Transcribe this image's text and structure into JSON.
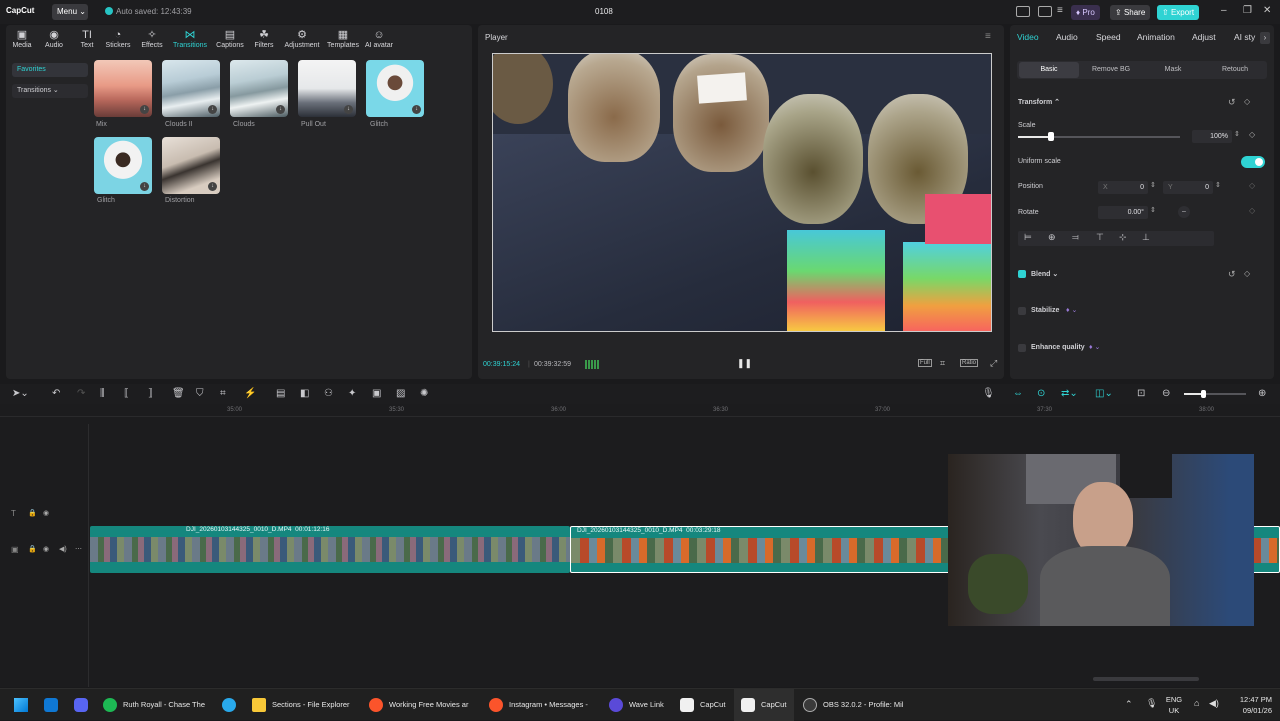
{
  "titlebar": {
    "logo": "CapCut",
    "menu": "Menu ⌄",
    "autosave": "Auto saved: 12:43:39",
    "project": "0108",
    "pro": "Pro",
    "share": "Share",
    "export": "Export"
  },
  "toptabs": [
    {
      "label": "Media",
      "icon": "media-icon"
    },
    {
      "label": "Audio",
      "icon": "audio-icon"
    },
    {
      "label": "Text",
      "icon": "text-icon"
    },
    {
      "label": "Stickers",
      "icon": "stickers-icon"
    },
    {
      "label": "Effects",
      "icon": "effects-icon"
    },
    {
      "label": "Transitions",
      "icon": "transitions-icon",
      "active": true
    },
    {
      "label": "Captions",
      "icon": "captions-icon"
    },
    {
      "label": "Filters",
      "icon": "filters-icon"
    },
    {
      "label": "Adjustment",
      "icon": "adjustment-icon"
    },
    {
      "label": "Templates",
      "icon": "templates-icon"
    },
    {
      "label": "AI avatar",
      "icon": "ai-avatar-icon"
    }
  ],
  "sidebar": {
    "favorites": "Favorites",
    "transitions": "Transitions ⌄"
  },
  "thumbs": [
    {
      "label": "Mix"
    },
    {
      "label": "Clouds II"
    },
    {
      "label": "Clouds"
    },
    {
      "label": "Pull Out"
    },
    {
      "label": "Glitch"
    },
    {
      "label": "Glitch"
    },
    {
      "label": "Distortion"
    }
  ],
  "player": {
    "title": "Player",
    "current": "00:39:15:24",
    "total": "00:39:32:59",
    "full": "Full",
    "ratio": "Ratio"
  },
  "props": {
    "tabs": [
      "Video",
      "Audio",
      "Speed",
      "Animation",
      "Adjust",
      "AI sty"
    ],
    "subtabs": [
      "Basic",
      "Remove BG",
      "Mask",
      "Retouch"
    ],
    "transform": "Transform ⌃",
    "scale": "Scale",
    "scale_val": "100%",
    "uniform": "Uniform scale",
    "position": "Position",
    "pos_x_label": "X",
    "pos_x": "0",
    "pos_y_label": "Y",
    "pos_y": "0",
    "rotate": "Rotate",
    "rotate_val": "0.00°",
    "blend": "Blend ⌄",
    "stabilize": "Stabilize",
    "enhance": "Enhance quality"
  },
  "ruler": [
    "35:00",
    "35:30",
    "36:00",
    "36:30",
    "37:00",
    "37:30",
    "38:00"
  ],
  "clips": [
    {
      "name": "DJI_20260103144325_0010_D.MP4",
      "duration": "00:01:12:16"
    },
    {
      "name": "DJI_20260103144325_0010_D.MP4",
      "duration": "00:03:29:18"
    }
  ],
  "taskbar": {
    "apps": [
      "Ruth Royall - Chase The",
      "Sections - File Explorer",
      "Working Free Movies ar",
      "Instagram • Messages -",
      "Wave Link",
      "CapCut",
      "CapCut",
      "OBS 32.0.2 - Profile: Mil"
    ],
    "lang": "ENG",
    "region": "UK",
    "time": "12:47 PM",
    "date": "09/01/26"
  },
  "colors": {
    "accent": "#2fd3d3",
    "clip": "#15877e"
  }
}
